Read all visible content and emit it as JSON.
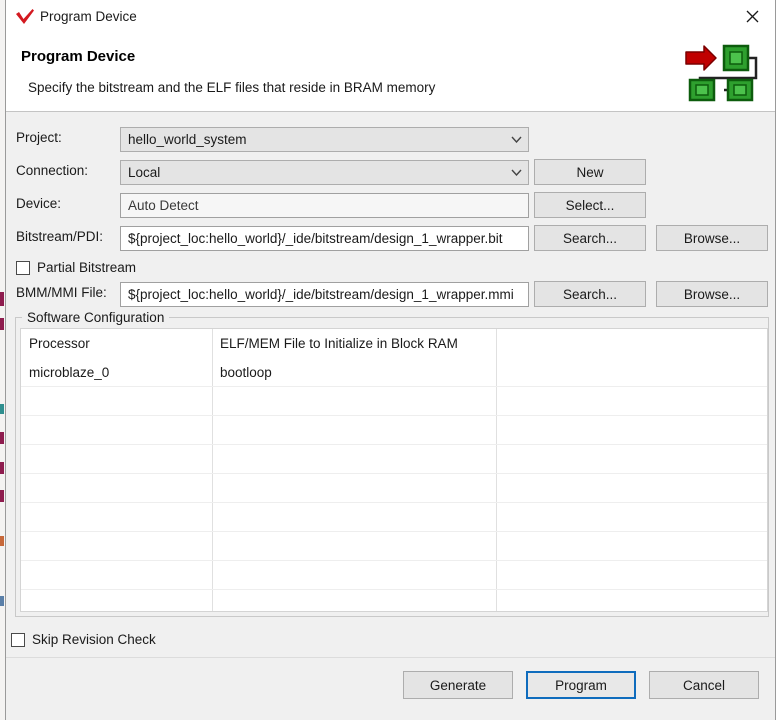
{
  "window": {
    "title": "Program Device",
    "logo_icon": "vitis-check-logo",
    "close_icon": "close-icon"
  },
  "header": {
    "title": "Program Device",
    "description": "Specify the bitstream and the ELF files that reside in BRAM memory",
    "icon": "program-device-flow-icon",
    "icon_arrow_color": "#c00000",
    "icon_block_color": "#2ea02e"
  },
  "form": {
    "project": {
      "label": "Project:",
      "value": "hello_world_system",
      "arrow_icon": "chevron-down-icon"
    },
    "connection": {
      "label": "Connection:",
      "value": "Local",
      "arrow_icon": "chevron-down-icon",
      "button": "New"
    },
    "device": {
      "label": "Device:",
      "value": "Auto Detect",
      "button": "Select..."
    },
    "bitstream": {
      "label": "Bitstream/PDI:",
      "value": "${project_loc:hello_world}/_ide/bitstream/design_1_wrapper.bit",
      "search_button": "Search...",
      "browse_button": "Browse..."
    },
    "partial_bitstream": {
      "label": "Partial Bitstream",
      "checked": false
    },
    "bmm_mmi": {
      "label": "BMM/MMI File:",
      "value": "${project_loc:hello_world}/_ide/bitstream/design_1_wrapper.mmi",
      "search_button": "Search...",
      "browse_button": "Browse..."
    }
  },
  "software_configuration": {
    "group_title": "Software Configuration",
    "columns": [
      "Processor",
      "ELF/MEM File to Initialize in Block RAM",
      ""
    ],
    "rows": [
      [
        "microblaze_0",
        "bootloop",
        ""
      ],
      [
        "",
        "",
        ""
      ],
      [
        "",
        "",
        ""
      ],
      [
        "",
        "",
        ""
      ],
      [
        "",
        "",
        ""
      ],
      [
        "",
        "",
        ""
      ],
      [
        "",
        "",
        ""
      ],
      [
        "",
        "",
        ""
      ],
      [
        "",
        "",
        ""
      ],
      [
        "",
        "",
        ""
      ]
    ]
  },
  "skip_revision_check": {
    "label": "Skip Revision Check",
    "checked": false
  },
  "actions": {
    "generate": "Generate",
    "program": "Program",
    "cancel": "Cancel"
  }
}
